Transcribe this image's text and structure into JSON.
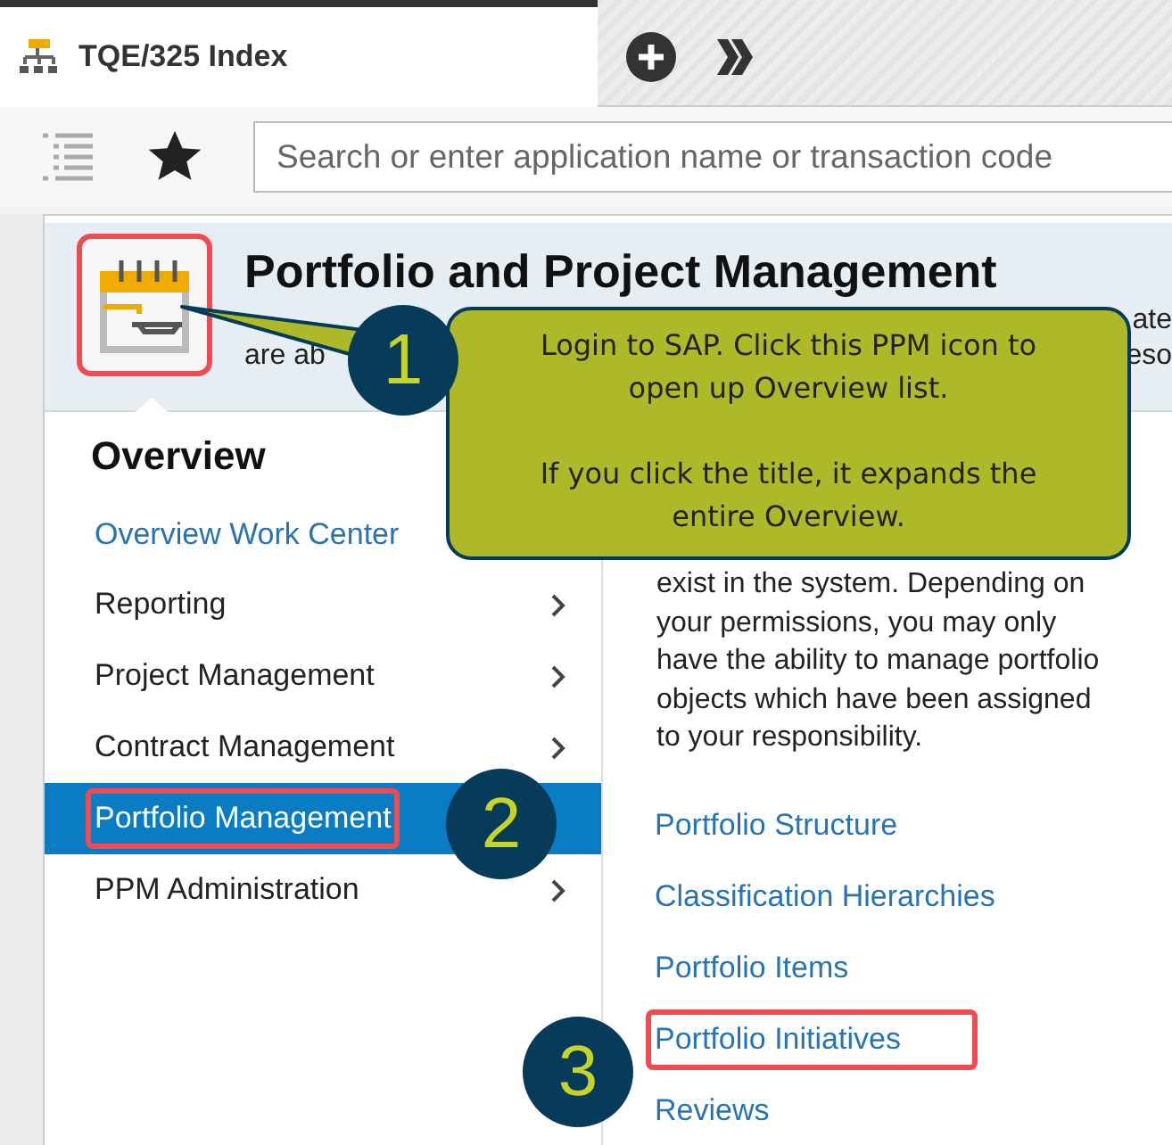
{
  "tab": {
    "title": "TQE/325 Index",
    "selected": true
  },
  "search": {
    "placeholder": "Search or enter application name or transaction code"
  },
  "header": {
    "title": "Portfolio and Project Management",
    "icon_highlighted": true,
    "fragments_left": [
      "are ab"
    ],
    "fragments_right": [
      "ate",
      "eso"
    ]
  },
  "overview": {
    "title": "Overview",
    "items": [
      {
        "label": "Overview Work Center",
        "kind": "link",
        "selected": false,
        "highlighted": false
      },
      {
        "label": "Reporting",
        "kind": "submenu",
        "selected": false,
        "highlighted": false
      },
      {
        "label": "Project Management",
        "kind": "submenu",
        "selected": false,
        "highlighted": false
      },
      {
        "label": "Contract Management",
        "kind": "submenu",
        "selected": false,
        "highlighted": false
      },
      {
        "label": "Portfolio Management",
        "kind": "submenu",
        "selected": true,
        "highlighted": true
      },
      {
        "label": "PPM Administration",
        "kind": "submenu",
        "selected": false,
        "highlighted": false
      }
    ]
  },
  "details": {
    "text": "exist in the system. Depending on your permissions, you may only have the ability to manage portfolio objects which have been assigned to your responsibility.",
    "links": [
      {
        "label": "Portfolio Structure",
        "highlighted": false
      },
      {
        "label": "Classification Hierarchies",
        "highlighted": false
      },
      {
        "label": "Portfolio Items",
        "highlighted": false
      },
      {
        "label": "Portfolio Initiatives",
        "highlighted": true
      },
      {
        "label": "Reviews",
        "highlighted": false
      }
    ]
  },
  "annotations": [
    {
      "number": "1",
      "lines": [
        "Login to SAP. Click this PPM icon to open up Overview list.",
        "If you click the title, it expands the entire Overview."
      ]
    },
    {
      "number": "2"
    },
    {
      "number": "3"
    }
  ]
}
